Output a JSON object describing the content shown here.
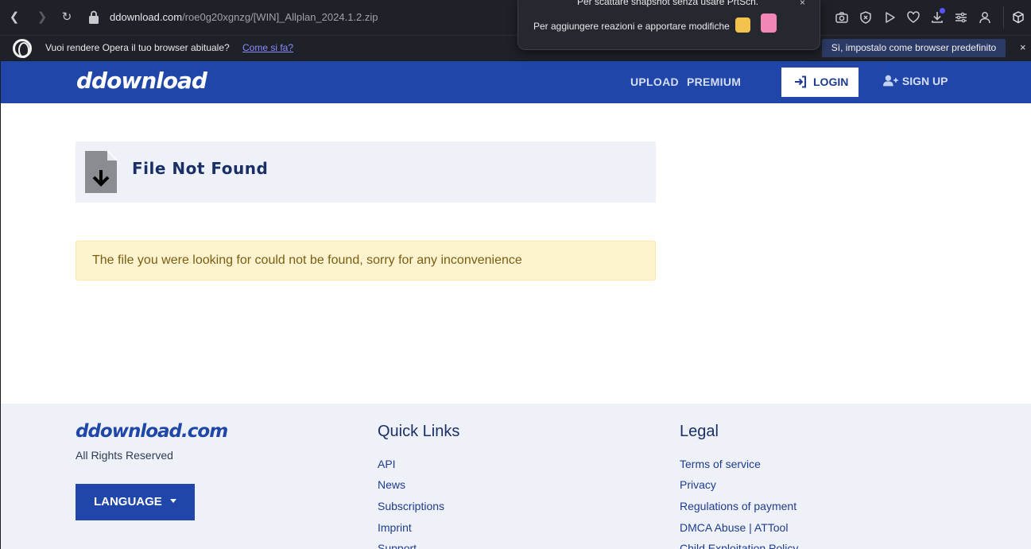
{
  "browser": {
    "url_host": "ddownload.com",
    "url_path": "/roe0g20xgnzg/[WIN]_Allplan_2024.1.2.zip",
    "popup_line1": "Per scattare snapshot senza usare PrtScn.",
    "popup_line2": "Per aggiungere reazioni e apportare modifiche",
    "popup_close": "×",
    "back_glyph": "❮",
    "forward_glyph": "❯",
    "reload_glyph": "↻",
    "icons": [
      "camera-icon",
      "shield-icon",
      "play-icon",
      "heart-icon",
      "download-icon",
      "easy-setup-icon",
      "profile-icon",
      "box-icon"
    ]
  },
  "opera_bar": {
    "text": "Vuoi rendere Opera il tuo browser abituale?",
    "link": "Come si fa?",
    "button": "Sì, impostalo come browser predefinito",
    "close": "×"
  },
  "header": {
    "logo": "ddownload",
    "nav": [
      "UPLOAD",
      "PREMIUM"
    ],
    "login": "LOGIN",
    "signup": "SIGN UP"
  },
  "main": {
    "title": "File Not Found",
    "alert": "The file you were looking for could not be found, sorry for any inconvenience"
  },
  "footer": {
    "logo": "ddownload.com",
    "rights": "All Rights Reserved",
    "language": "LANGUAGE",
    "quick_links_title": "Quick Links",
    "quick_links": [
      "API",
      "News",
      "Subscriptions",
      "Imprint",
      "Support"
    ],
    "legal_title": "Legal",
    "legal_links": [
      "Terms of service",
      "Privacy",
      "Regulations of payment",
      "DMCA Abuse | ATTool",
      "Child Exploitation Policy"
    ]
  },
  "colors": {
    "header_bg": "#1f46a8",
    "alert_bg": "#fdf3cf",
    "footer_bg": "#eef2f8",
    "title_color": "#1b2f66"
  }
}
